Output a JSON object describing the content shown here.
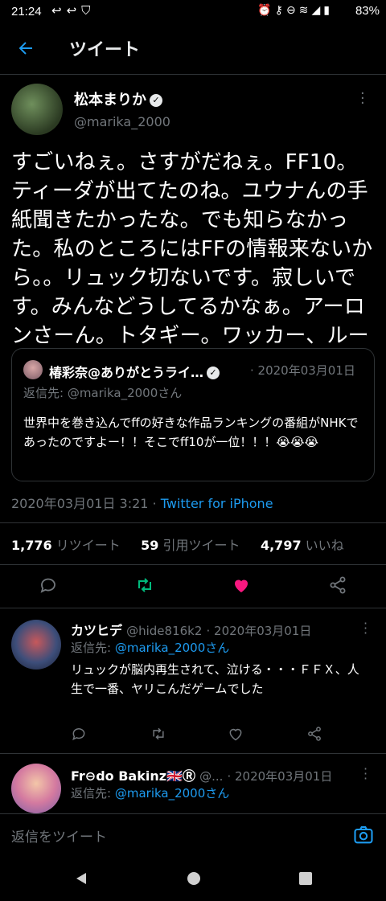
{
  "status_bar": {
    "time": "21:24",
    "battery": "83%",
    "left_icons": [
      "reply-arrow-icon",
      "reply-arrow-icon",
      "shield-icon"
    ],
    "right_icons": [
      "alarm-icon",
      "key-icon",
      "minus-circle-icon",
      "wifi-icon",
      "signal-icon",
      "battery-icon"
    ]
  },
  "header": {
    "title": "ツイート"
  },
  "tweet": {
    "author_name": "松本まりか",
    "verified_icon": "verified-badge-icon",
    "handle": "@marika_2000",
    "body": "すごいねぇ。さすがだねぇ。FF10。ティーダが出てたのね。ユウナんの手紙聞きたかったな。でも知らなかった。私のところにはFFの情報来ないから。。リュック切ないです。寂しいです。みんなどうしてるかなぁ。アーロンさーん。トタギー。ワッカー、ルー",
    "quote": {
      "author_name": "椿彩奈@ありがとうライ…",
      "date": "· 2020年03月01日",
      "reply_to": "返信先: @marika_2000さん",
      "body": "世界中を巻き込んでffの好きな作品ランキングの番組がNHKであったのですよー！！そこでff10が一位！！！😭😭😭"
    },
    "timestamp": "2020年03月01日 3:21",
    "separator": " · ",
    "client": "Twitter for iPhone",
    "stats": {
      "retweets_count": "1,776",
      "retweets_label": "リツイート",
      "quotes_count": "59",
      "quotes_label": "引用ツイート",
      "likes_count": "4,797",
      "likes_label": "いいね"
    },
    "colors": {
      "retweet": "#00ba7c",
      "like": "#f91880",
      "link": "#1d9bf0"
    }
  },
  "replies": [
    {
      "name": "カツヒデ",
      "handle": "@hide816k2",
      "date": "· 2020年03月01日",
      "reply_to_prefix": "返信先:",
      "reply_to_handle": "@marika_2000さん",
      "body": "リュックが脳内再生されて、泣ける・・・ＦＦＸ、人生で一番、ヤリこんだゲームでした"
    },
    {
      "name": "Fr⊖do Bakinz🇬🇧Ⓡ",
      "handle": "@...",
      "date": "· 2020年03月01日",
      "reply_to_prefix": "返信先:",
      "reply_to_handle": "@marika_2000さん"
    }
  ],
  "reply_bar": {
    "placeholder": "返信をツイート"
  }
}
